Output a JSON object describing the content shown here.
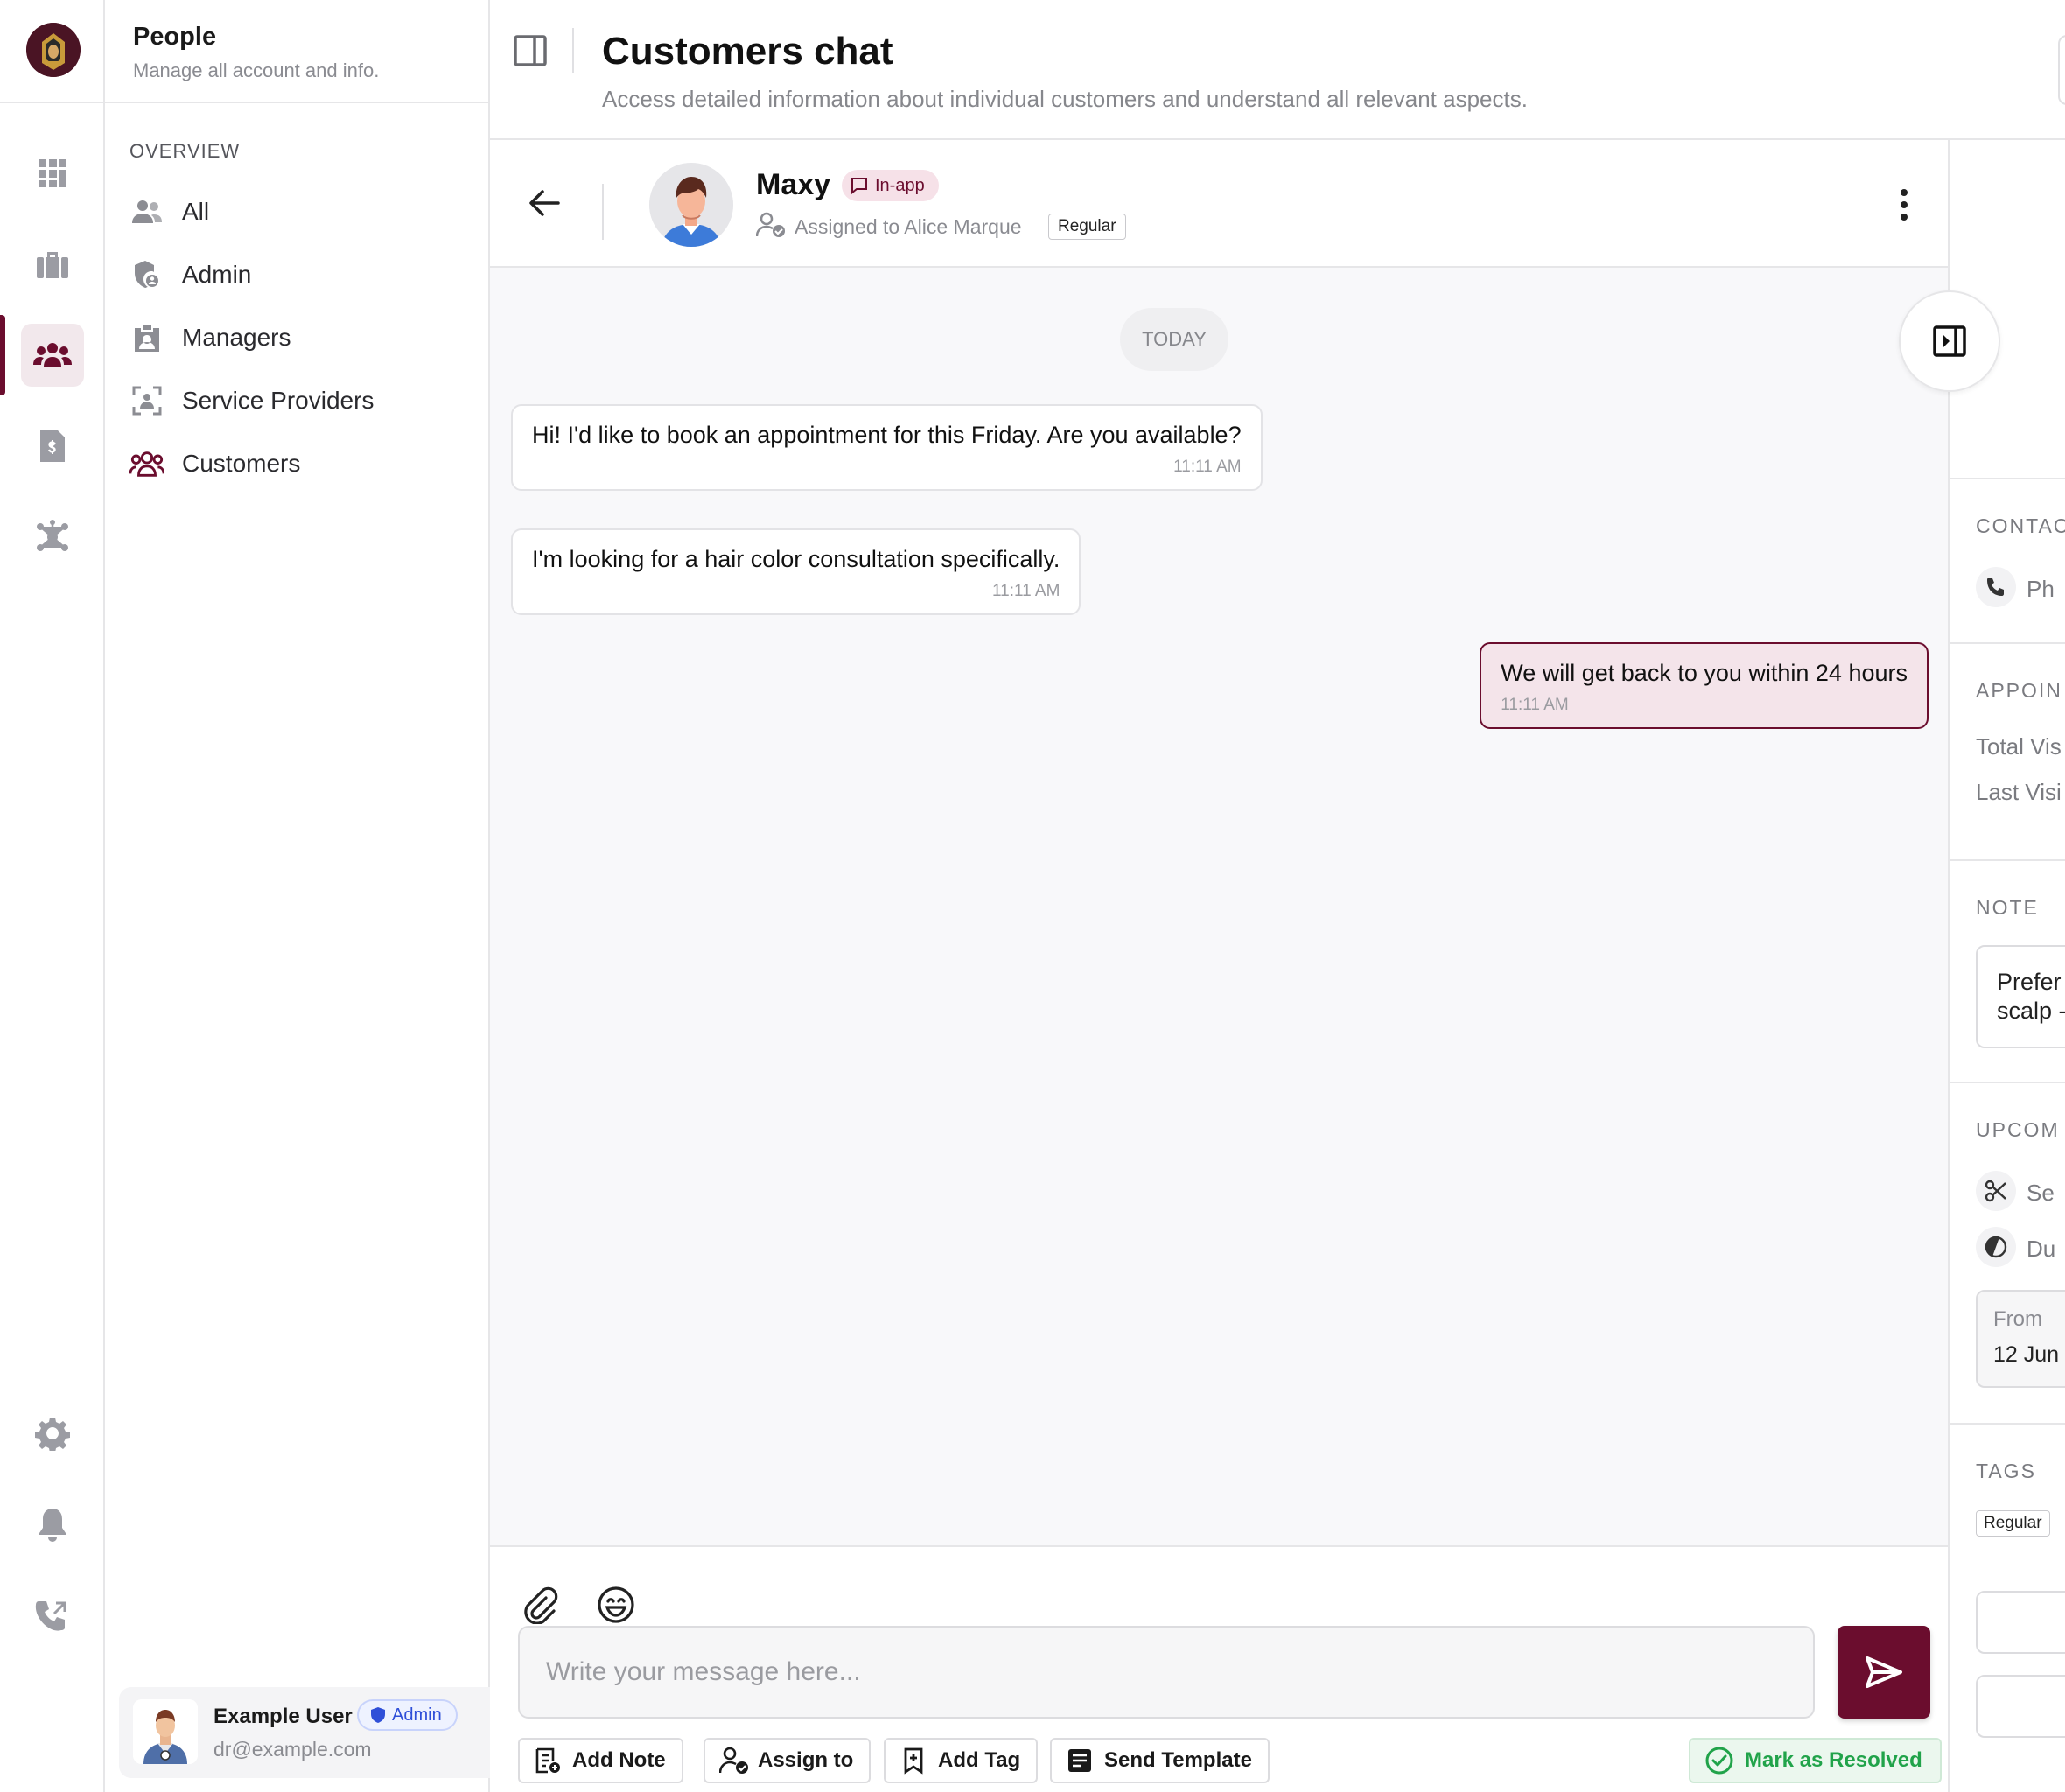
{
  "app": {
    "brand_color": "#6b0d2e",
    "rail": [
      "dashboard-grid-icon",
      "briefcase-icon",
      "people-icon",
      "invoice-icon",
      "network-icon",
      "gear-icon",
      "bell-icon",
      "phone-icon"
    ],
    "active_rail": "people-icon"
  },
  "nav": {
    "title": "People",
    "subtitle": "Manage all account and info.",
    "section": "OVERVIEW",
    "items": [
      {
        "label": "All",
        "icon": "users-icon"
      },
      {
        "label": "Admin",
        "icon": "shield-user-icon"
      },
      {
        "label": "Managers",
        "icon": "id-badge-icon"
      },
      {
        "label": "Service Providers",
        "icon": "scan-person-icon"
      },
      {
        "label": "Customers",
        "icon": "customers-icon"
      }
    ],
    "active_item": "Customers"
  },
  "user": {
    "name": "Example User",
    "role": "Admin",
    "email": "dr@example.com"
  },
  "header": {
    "title": "Customers chat",
    "subtitle": "Access detailed information about individual customers and understand all relevant aspects."
  },
  "chat": {
    "customer": {
      "name": "Maxy",
      "channel": "In-app",
      "assigned": "Assigned to Alice Marque",
      "type": "Regular"
    },
    "day_label": "TODAY",
    "messages": [
      {
        "direction": "in",
        "text": "Hi! I'd like to book an appointment for this Friday. Are you available?",
        "time": "11:11 AM"
      },
      {
        "direction": "in",
        "text": "I'm looking for a hair color consultation specifically.",
        "time": "11:11 AM"
      },
      {
        "direction": "out",
        "text": "We will get back to you within 24 hours",
        "time": "11:11 AM"
      }
    ],
    "composer": {
      "placeholder": "Write your message here...",
      "value": ""
    },
    "actions": {
      "add_note": "Add Note",
      "assign_to": "Assign to",
      "add_tag": "Add Tag",
      "send_template": "Send Template",
      "resolve": "Mark as Resolved"
    }
  },
  "details": {
    "contact_section": "CONTAC",
    "phone_label": "Ph",
    "appointments_section": "APPOIN",
    "total_visits": "Total Vis",
    "last_visit": "Last Visi",
    "note_section": "NOTE",
    "note_line1": "Prefer",
    "note_line2": "scalp -",
    "upcoming_section": "UPCOM",
    "service_label": "Se",
    "duration_label": "Du",
    "from_label": "From",
    "from_value": "12 Jun",
    "tags_section": "TAGS",
    "tag": "Regular"
  }
}
